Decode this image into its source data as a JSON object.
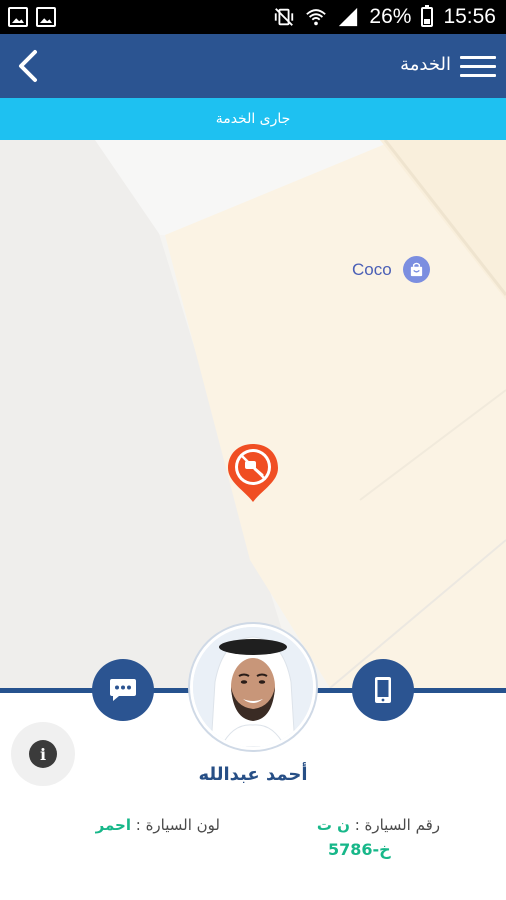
{
  "status_bar": {
    "battery_percent": "26%",
    "time": "15:56",
    "icons": [
      "gallery-icon",
      "image-icon",
      "mute-vibrate-icon",
      "wifi-icon",
      "signal-icon",
      "battery-icon"
    ]
  },
  "app_bar": {
    "title": "الخدمة",
    "back_icon": "chevron-left-icon",
    "menu_icon": "hamburger-menu-icon",
    "background": "#2b5491"
  },
  "status_strip": {
    "text": "جارى الخدمة",
    "background": "#1ec1f1"
  },
  "map": {
    "poi_label": "Coco",
    "poi_icon": "shopping-bag-icon",
    "pin_icon": "service-location-pin-icon"
  },
  "driver": {
    "name": "أحمد عبدالله",
    "car_number_label": "رقم السيارة : ",
    "car_number_letters": "ن ت",
    "car_number_digits": "خ-5786",
    "car_color_label": "لون السيارة : ",
    "car_color_value": "احمر"
  },
  "actions": {
    "chat_icon": "chat-bubble-icon",
    "phone_icon": "mobile-phone-icon",
    "info_icon": "info-icon"
  },
  "colors": {
    "primary": "#2b5491",
    "accent": "#1ec1f1",
    "green": "#17b789",
    "pin": "#f04e23"
  }
}
